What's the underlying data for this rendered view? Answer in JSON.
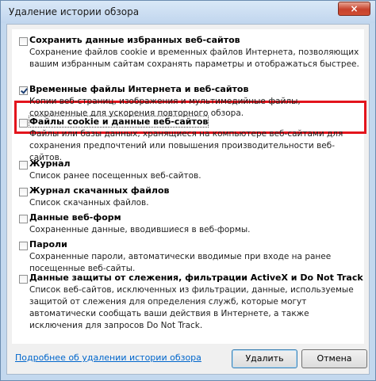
{
  "window": {
    "title": "Удаление истории обзора",
    "close_glyph": "×"
  },
  "options": [
    {
      "label": "Сохранить данные избранных веб-сайтов",
      "checked": false,
      "desc": "Сохранение файлов cookie и временных файлов Интернета, позволяющих вашим избранным сайтам сохранять параметры и отображаться быстрее."
    },
    {
      "label": "Временные файлы Интернета и веб-сайтов",
      "checked": true,
      "desc": "Копии веб-страниц, изображения и мультимедийные файлы, сохраненные для ускорения повторного обзора."
    },
    {
      "label": "Файлы cookie и данные веб-сайтов",
      "checked": false,
      "desc": "Файлы или базы данных, хранящиеся на компьютере веб-сайтами для сохранения предпочтений или повышения производительности веб-сайтов."
    },
    {
      "label": "Журнал",
      "checked": false,
      "desc": "Список ранее посещенных веб-сайтов."
    },
    {
      "label": "Журнал скачанных файлов",
      "checked": false,
      "desc": "Список скачанных файлов."
    },
    {
      "label": "Данные веб-форм",
      "checked": false,
      "desc": "Сохраненные данные, вводившиеся в веб-формы."
    },
    {
      "label": "Пароли",
      "checked": false,
      "desc": "Сохраненные пароли, автоматически вводимые при входе на ранее посещенные веб-сайты."
    },
    {
      "label": "Данные защиты от слежения, фильтрации ActiveX и Do Not Track",
      "checked": false,
      "desc": "Список веб-сайтов, исключенных из фильтрации, данные, используемые защитой от слежения для определения служб, которые могут автоматически сообщать ваши действия в Интернете, а также исключения для запросов Do Not Track."
    }
  ],
  "footer": {
    "link": "Подробнее об удалении истории обзора",
    "delete_label": "Удалить",
    "cancel_label": "Отмена"
  },
  "colors": {
    "highlight": "#e3141c",
    "link": "#0066cc"
  }
}
